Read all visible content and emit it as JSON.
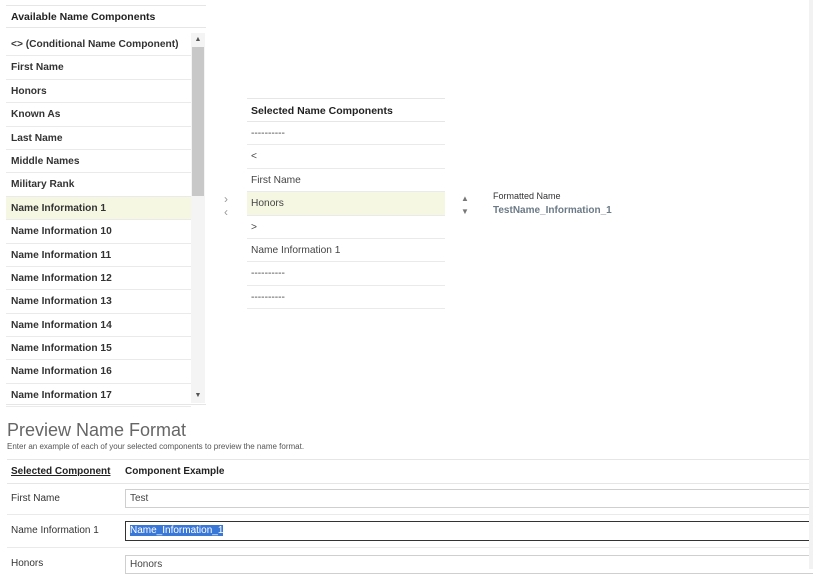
{
  "available": {
    "header": "Available Name Components",
    "items": [
      "<> (Conditional Name Component)",
      "First Name",
      "Honors",
      "Known As",
      "Last Name",
      "Middle Names",
      "Military Rank",
      "Name Information 1",
      "Name Information 10",
      "Name Information 11",
      "Name Information 12",
      "Name Information 13",
      "Name Information 14",
      "Name Information 15",
      "Name Information 16",
      "Name Information 17"
    ],
    "selected_index": 7
  },
  "move": {
    "add_icon": "chevron-right-icon",
    "remove_icon": "chevron-left-icon"
  },
  "selected": {
    "header": "Selected Name Components",
    "items": [
      "----------",
      "<",
      "First Name",
      "Honors",
      ">",
      "Name Information 1",
      "----------",
      "----------"
    ],
    "selected_index": 3
  },
  "order": {
    "up_icon": "triangle-up-icon",
    "down_icon": "triangle-down-icon"
  },
  "formatted": {
    "label": "Formatted Name",
    "value": "TestName_Information_1"
  },
  "preview": {
    "title": "Preview Name Format",
    "subtitle": "Enter an example of each of your selected components to preview the name format.",
    "col_component": "Selected Component",
    "col_example": "Component Example",
    "rows": [
      {
        "component": "First Name",
        "example": "Test"
      },
      {
        "component": "Name Information 1",
        "example": "Name_Information_1"
      },
      {
        "component": "Honors",
        "example": "Honors"
      }
    ]
  },
  "colors": {
    "selected_row": "#f6f7e3",
    "highlight": "#3a78d8"
  }
}
